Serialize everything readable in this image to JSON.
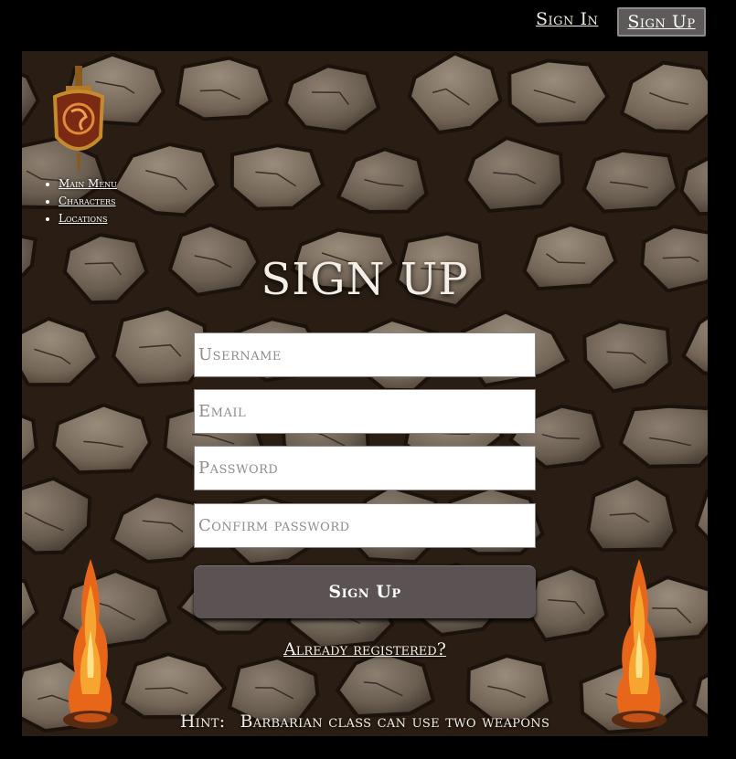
{
  "header": {
    "sign_in_label": "Sign In",
    "sign_up_label": "Sign Up"
  },
  "sidebar": {
    "items": [
      {
        "label": "Main Menu"
      },
      {
        "label": "Characters"
      },
      {
        "label": "Locations"
      }
    ]
  },
  "form": {
    "title": "SIGN UP",
    "username_placeholder": "Username",
    "email_placeholder": "Email",
    "password_placeholder": "Password",
    "confirm_placeholder": "Confirm password",
    "submit_label": "Sign Up",
    "already_registered": "Already registered?"
  },
  "hint": {
    "label": "Hint:",
    "text": "Barbarian class can use two weapons"
  },
  "icons": {
    "logo": "dragon-shield-sword-icon",
    "torch": "fire-icon"
  },
  "colors": {
    "page_background": "#000000",
    "button_gray": "#5a5253",
    "text_light": "#f4efe6"
  }
}
